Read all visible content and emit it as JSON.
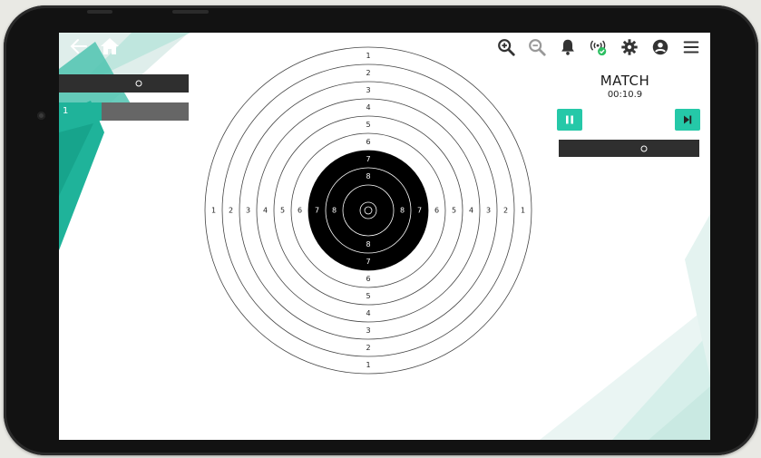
{
  "match": {
    "title": "MATCH",
    "time": "00:10.9"
  },
  "left_panel": {
    "shot_number": "1"
  },
  "toolbar": {
    "icons": [
      "zoom-in-icon",
      "zoom-out-icon",
      "bell-icon",
      "connection-status-icon",
      "settings-icon",
      "account-icon",
      "menu-icon"
    ]
  },
  "colors": {
    "accent": "#25c8a8",
    "dark_bar": "#2f2f2f",
    "target_black": "#000000"
  },
  "target": {
    "outer_labels": [
      "1",
      "2",
      "3",
      "4",
      "5",
      "6"
    ],
    "black_labels": [
      "7",
      "8"
    ]
  }
}
